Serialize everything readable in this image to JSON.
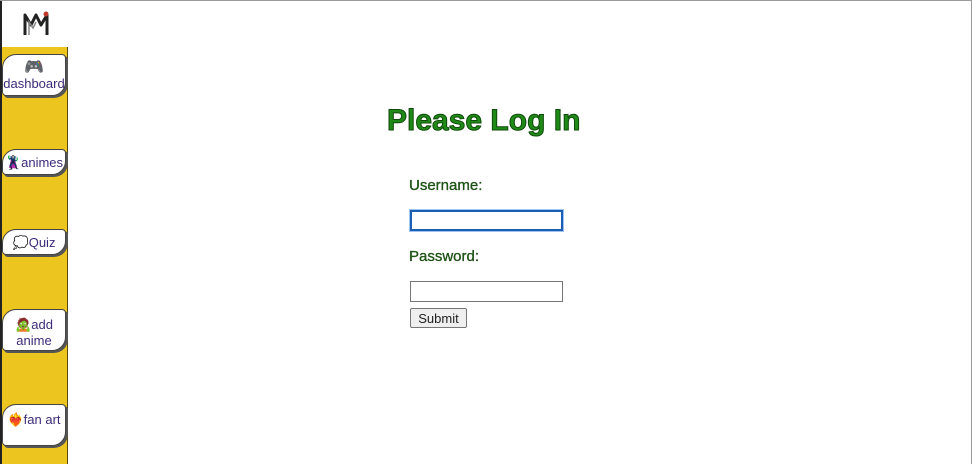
{
  "sidebar": {
    "logo_icon": "mm-monogram-logo",
    "items": [
      {
        "label": "dashboard",
        "icon": "🎮",
        "icon_name": "gamepad-icon"
      },
      {
        "label": "animes",
        "icon": "🦹",
        "icon_name": "anime-character-icon"
      },
      {
        "label": "Quiz",
        "icon": "💭",
        "icon_name": "thought-bubble-icon"
      },
      {
        "label": "add anime",
        "icon": "🧟",
        "icon_name": "character-add-icon"
      },
      {
        "label": "fan art",
        "icon": "❤️‍🔥",
        "icon_name": "heart-fire-icon"
      }
    ],
    "background_color": "#ecc51f",
    "link_color": "#3e2a7a"
  },
  "login": {
    "title": "Please Log In",
    "username_label": "Username:",
    "username_value": "",
    "password_label": "Password:",
    "password_value": "",
    "submit_label": "Submit",
    "title_color": "#1f8a17",
    "label_color": "#1f5a15"
  }
}
